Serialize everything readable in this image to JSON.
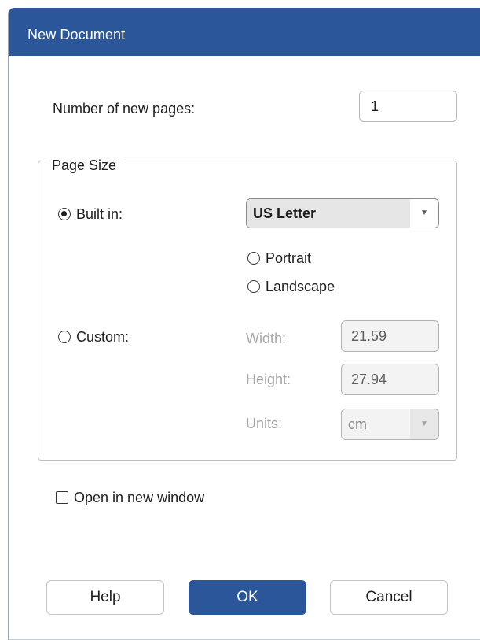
{
  "dialog": {
    "title": "New Document"
  },
  "pages": {
    "label": "Number of new pages:",
    "value": "1"
  },
  "page_size": {
    "legend": "Page Size",
    "built_in": {
      "label": "Built in:",
      "checked": true,
      "selected": "US Letter"
    },
    "orientation": {
      "portrait_label": "Portrait",
      "landscape_label": "Landscape"
    },
    "custom": {
      "label": "Custom:",
      "checked": false,
      "width_label": "Width:",
      "width_value": "21.59",
      "height_label": "Height:",
      "height_value": "27.94",
      "units_label": "Units:",
      "units_value": "cm"
    }
  },
  "options": {
    "open_new_window_label": "Open in new window",
    "open_new_window_checked": false
  },
  "buttons": {
    "help": "Help",
    "ok": "OK",
    "cancel": "Cancel"
  },
  "colors": {
    "accent": "#2b579a",
    "disabled_text": "#a6a6a6"
  }
}
